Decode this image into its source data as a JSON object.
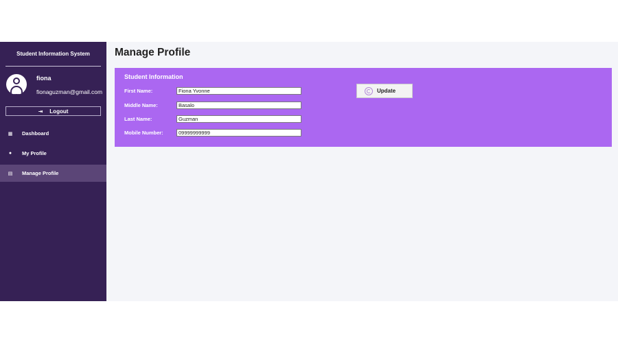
{
  "sidebar": {
    "title": "Student Information System",
    "user": {
      "name": "fiona",
      "email": "fionaguzman@gmail.com"
    },
    "logout_label": "Logout",
    "items": [
      {
        "label": "Dashboard",
        "icon": "grid-icon"
      },
      {
        "label": "My Profile",
        "icon": "user-icon"
      },
      {
        "label": "Manage Profile",
        "icon": "edit-icon",
        "active": true
      }
    ]
  },
  "main": {
    "title": "Manage Profile",
    "card": {
      "title": "Student Information",
      "fields": [
        {
          "label": "First Name:",
          "value": "Fiona Yvonne"
        },
        {
          "label": "Middle Name:",
          "value": "Basalo"
        },
        {
          "label": "Last Name:",
          "value": "Guzman"
        },
        {
          "label": "Mobile Number:",
          "value": "09999999999"
        }
      ],
      "update_label": "Update"
    }
  },
  "colors": {
    "sidebar": "#362155",
    "card": "#ab67f1",
    "active_item": "#5b4577",
    "background": "#f4f5f9"
  }
}
